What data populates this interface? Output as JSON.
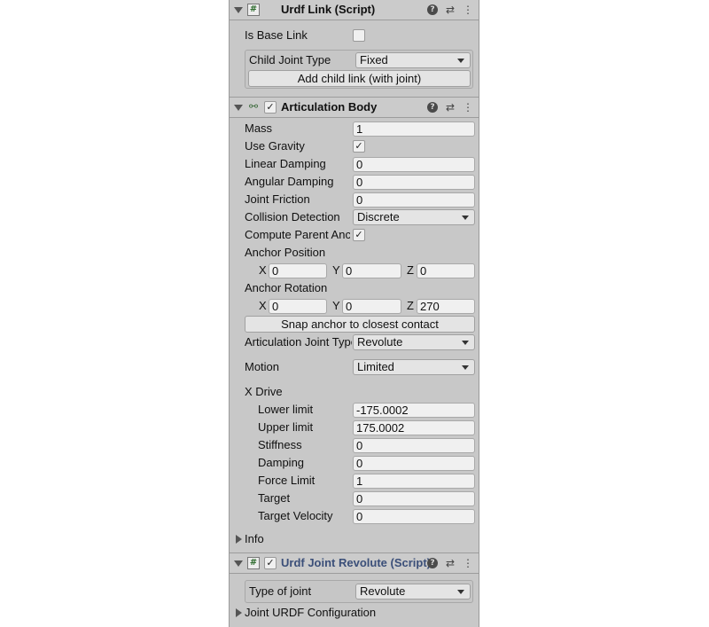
{
  "urdf_link": {
    "title": "Urdf Link (Script)",
    "script_icon": "#",
    "is_base_link_label": "Is Base Link",
    "is_base_link_checked": false,
    "child_joint_type_label": "Child Joint Type",
    "child_joint_type_value": "Fixed",
    "add_child_link_label": "Add child link (with joint)"
  },
  "articulation_body": {
    "title": "Articulation Body",
    "enabled": true,
    "enabled_mark": "✓",
    "mass_label": "Mass",
    "mass_value": "1",
    "use_gravity_label": "Use Gravity",
    "use_gravity_mark": "✓",
    "linear_damping_label": "Linear Damping",
    "linear_damping_value": "0",
    "angular_damping_label": "Angular Damping",
    "angular_damping_value": "0",
    "joint_friction_label": "Joint Friction",
    "joint_friction_value": "0",
    "collision_detection_label": "Collision Detection",
    "collision_detection_value": "Discrete",
    "compute_parent_anchor_label": "Compute Parent Anchor",
    "compute_parent_anchor_mark": "✓",
    "anchor_position_label": "Anchor Position",
    "anchor_position": {
      "x_label": "X",
      "x": "0",
      "y_label": "Y",
      "y": "0",
      "z_label": "Z",
      "z": "0"
    },
    "anchor_rotation_label": "Anchor Rotation",
    "anchor_rotation": {
      "x_label": "X",
      "x": "0",
      "y_label": "Y",
      "y": "0",
      "z_label": "Z",
      "z": "270"
    },
    "snap_anchor_label": "Snap anchor to closest contact",
    "articulation_joint_type_label": "Articulation Joint Type",
    "articulation_joint_type_value": "Revolute",
    "motion_label": "Motion",
    "motion_value": "Limited",
    "x_drive_label": "X Drive",
    "x_drive": {
      "lower_limit_label": "Lower limit",
      "lower_limit": "-175.0002",
      "upper_limit_label": "Upper limit",
      "upper_limit": "175.0002",
      "stiffness_label": "Stiffness",
      "stiffness": "0",
      "damping_label": "Damping",
      "damping": "0",
      "force_limit_label": "Force Limit",
      "force_limit": "1",
      "target_label": "Target",
      "target": "0",
      "target_velocity_label": "Target Velocity",
      "target_velocity": "0"
    },
    "info_label": "Info"
  },
  "urdf_joint_revolute": {
    "title": "Urdf Joint Revolute (Script)",
    "script_icon": "#",
    "enabled_mark": "✓",
    "type_of_joint_label": "Type of joint",
    "type_of_joint_value": "Revolute",
    "joint_urdf_configuration_label": "Joint URDF Configuration"
  },
  "icons": {
    "help": "?",
    "presets": "⇄",
    "menu": "⋮",
    "articulation": "⚯"
  }
}
